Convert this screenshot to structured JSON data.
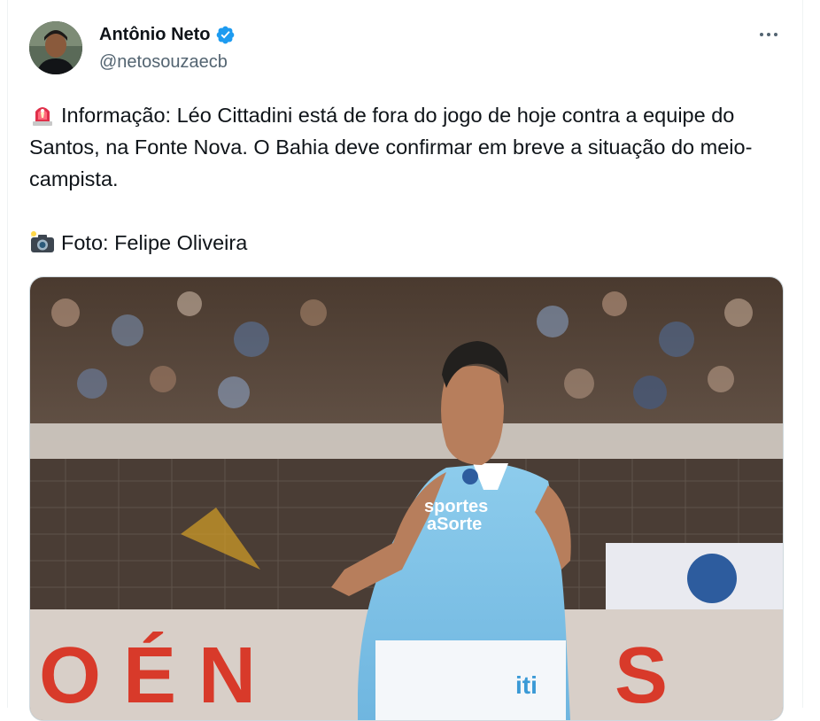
{
  "author": {
    "display_name": "Antônio Neto",
    "handle": "@netosouzaecb",
    "verified": true,
    "avatar_icon": "user-avatar-photo"
  },
  "tweet": {
    "paragraph_1": "Informação: Léo Cittadini está de fora do jogo de hoje contra a equipe do Santos, na Fonte Nova. O Bahia deve confirmar em breve a situação do meio-campista.",
    "paragraph_2": "Foto: Felipe Oliveira",
    "emoji_1": "rotating-light-icon",
    "emoji_2": "camera-flash-icon"
  },
  "media": {
    "shirt_sponsor": "sportes\naSorte",
    "shorts_sponsor": "iti"
  },
  "colors": {
    "text_primary": "#0f1419",
    "text_secondary": "#536471",
    "verified_blue": "#1d9bf0",
    "jersey_blue": "#7fc3e8"
  },
  "more_icon": "more-horizontal-icon"
}
